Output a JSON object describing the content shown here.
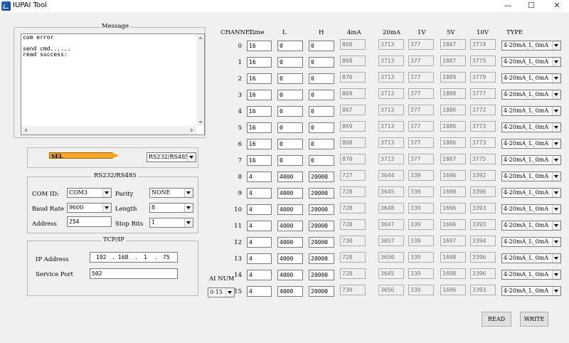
{
  "window": {
    "title": "IUPAI Tool",
    "minimize": "—",
    "maximize": "☐",
    "close": "✕"
  },
  "message": {
    "title": "Message",
    "lines": [
      "com error",
      "",
      "send cmd......",
      "read success:"
    ]
  },
  "sel": {
    "label": "SEL",
    "mode": "RS232/RS485"
  },
  "rs": {
    "title": "RS232/RS485",
    "com_label": "COM ID:",
    "com_value": "COM3",
    "parity_label": "Parity",
    "parity_value": "NONE",
    "baud_label": "Baud Rate",
    "baud_value": "9600",
    "length_label": "Length",
    "length_value": "8",
    "address_label": "Address",
    "address_value": "254",
    "stop_label": "Stop Bits",
    "stop_value": "1"
  },
  "tcp": {
    "title": "TCP/IP",
    "ip_label": "IP Address",
    "ip": [
      "192",
      "168",
      "1",
      "75"
    ],
    "port_label": "Service Port",
    "port_value": "502"
  },
  "ai": {
    "label": "AI NUM",
    "value": "0-15"
  },
  "headers": [
    "CHANNEL",
    "Time",
    "L",
    "H",
    "4mA",
    "20mA",
    "1V",
    "5V",
    "10V",
    "TYPE"
  ],
  "channels": [
    [
      "0",
      "16",
      "0",
      "0",
      "868",
      "3713",
      "377",
      "1887",
      "3774",
      "4-20mA_L_0mA"
    ],
    [
      "1",
      "16",
      "0",
      "0",
      "868",
      "3713",
      "377",
      "1887",
      "3775",
      "4-20mA_L_0mA"
    ],
    [
      "2",
      "16",
      "0",
      "0",
      "870",
      "3713",
      "377",
      "1889",
      "3779",
      "4-20mA_L_0mA"
    ],
    [
      "3",
      "16",
      "0",
      "0",
      "869",
      "3713",
      "377",
      "1888",
      "3777",
      "4-20mA_L_0mA"
    ],
    [
      "4",
      "16",
      "0",
      "0",
      "867",
      "3713",
      "377",
      "1886",
      "3772",
      "4-20mA_L_0mA"
    ],
    [
      "5",
      "16",
      "0",
      "0",
      "869",
      "3713",
      "377",
      "1886",
      "3773",
      "4-20mA_L_0mA"
    ],
    [
      "6",
      "16",
      "0",
      "0",
      "868",
      "3713",
      "377",
      "1886",
      "3773",
      "4-20mA_L_0mA"
    ],
    [
      "7",
      "16",
      "0",
      "0",
      "870",
      "3713",
      "377",
      "1887",
      "3775",
      "4-20mA_L_0mA"
    ],
    [
      "8",
      "4",
      "4000",
      "20000",
      "727",
      "3644",
      "339",
      "1696",
      "3392",
      "4-20mA_L_0mA"
    ],
    [
      "9",
      "4",
      "4000",
      "20000",
      "728",
      "3645",
      "339",
      "1698",
      "3396",
      "4-20mA_L_0mA"
    ],
    [
      "10",
      "4",
      "4000",
      "20000",
      "728",
      "3648",
      "339",
      "1696",
      "3393",
      "4-20mA_L_0mA"
    ],
    [
      "11",
      "4",
      "4000",
      "20000",
      "728",
      "3647",
      "339",
      "1696",
      "3393",
      "4-20mA_L_0mA"
    ],
    [
      "12",
      "4",
      "4000",
      "20000",
      "730",
      "3657",
      "339",
      "1697",
      "3394",
      "4-20mA_L_0mA"
    ],
    [
      "13",
      "4",
      "4000",
      "20000",
      "728",
      "3650",
      "339",
      "1698",
      "3396",
      "4-20mA_L_0mA"
    ],
    [
      "14",
      "4",
      "4000",
      "20000",
      "728",
      "3645",
      "339",
      "1698",
      "3396",
      "4-20mA_L_0mA"
    ],
    [
      "15",
      "4",
      "4000",
      "20000",
      "730",
      "3656",
      "339",
      "1696",
      "3393",
      "4-20mA_L_0mA"
    ]
  ],
  "buttons": {
    "read": "READ",
    "write": "WRITE"
  }
}
